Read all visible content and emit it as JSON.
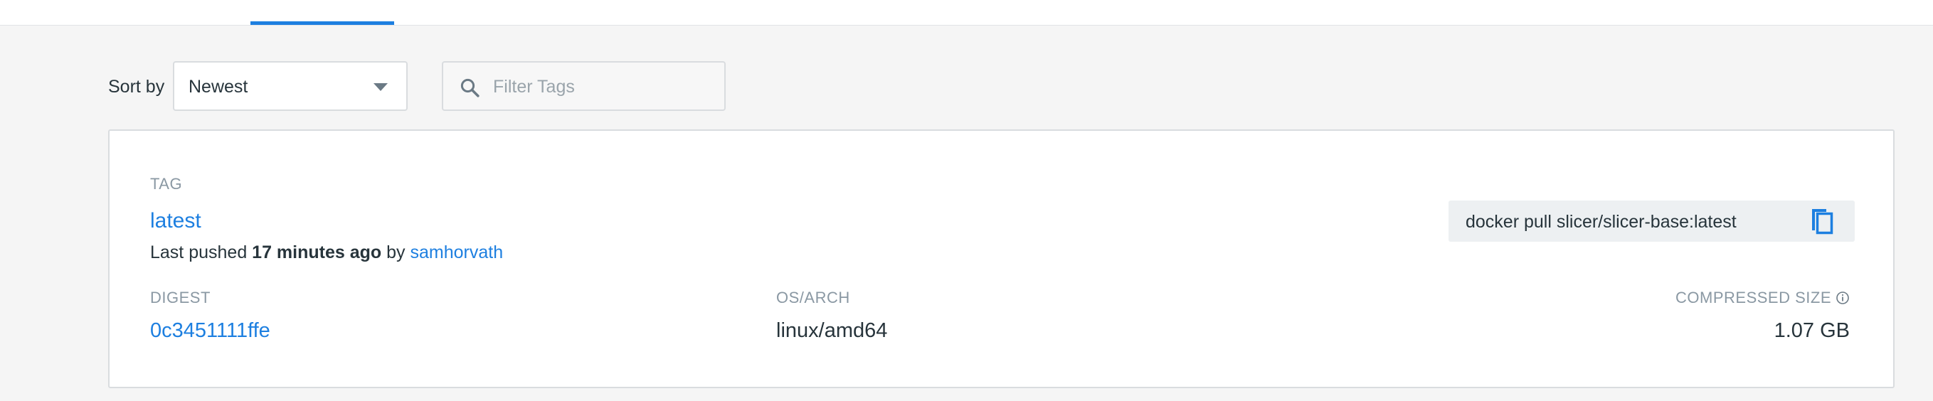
{
  "sort": {
    "label": "Sort by",
    "selected": "Newest"
  },
  "filter": {
    "placeholder": "Filter Tags",
    "value": ""
  },
  "tag": {
    "section_label": "TAG",
    "name": "latest",
    "pushed_prefix": "Last pushed",
    "pushed_time": "17 minutes ago",
    "pushed_by_word": "by",
    "pushed_by_user": "samhorvath",
    "pull_command": "docker pull slicer/slicer-base:latest",
    "digest_label": "DIGEST",
    "digest": "0c3451111ffe",
    "os_arch_label": "OS/ARCH",
    "os_arch": "linux/amd64",
    "size_label": "COMPRESSED SIZE",
    "size": "1.07 GB"
  },
  "colors": {
    "accent": "#1d7fe0",
    "text": "#27343b",
    "muted": "#8a98a3",
    "background": "#f5f5f5"
  },
  "icons": {
    "search": "search-icon",
    "caret": "chevron-down-icon",
    "copy": "copy-icon",
    "info": "info-icon"
  }
}
